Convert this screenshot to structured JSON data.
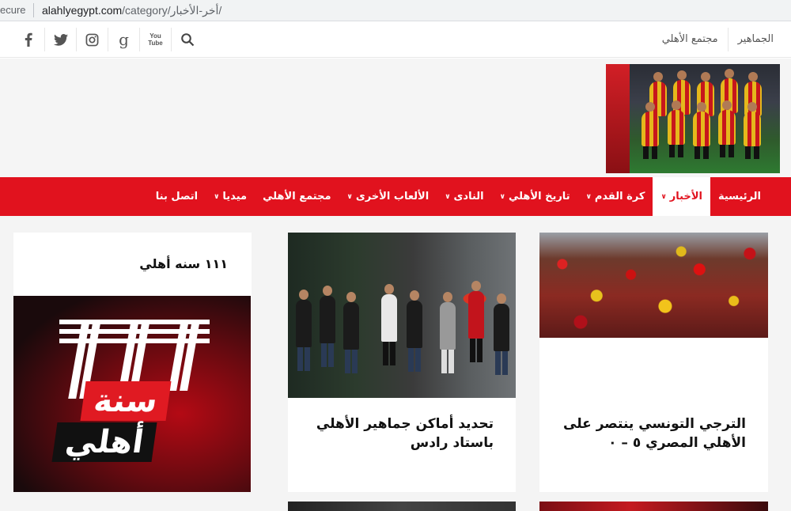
{
  "browser": {
    "secure_label": "ecure",
    "url_host": "alahlyegypt.com",
    "url_path": "/category/أخر-الأخبار/"
  },
  "topbar": {
    "links": [
      "الجماهير",
      "مجتمع الأهلي"
    ],
    "social_icons": [
      "facebook-icon",
      "twitter-icon",
      "instagram-icon",
      "google-icon",
      "youtube-icon",
      "search-icon"
    ],
    "youtube_text": "You Tube"
  },
  "nav": {
    "items": [
      {
        "label": "الرئيسية",
        "has_caret": false,
        "active": false
      },
      {
        "label": "الأخبار",
        "has_caret": true,
        "active": true
      },
      {
        "label": "كرة القدم",
        "has_caret": true,
        "active": false
      },
      {
        "label": "تاريخ الأهلي",
        "has_caret": true,
        "active": false
      },
      {
        "label": "النادى",
        "has_caret": true,
        "active": false
      },
      {
        "label": "الألعاب الأخرى",
        "has_caret": true,
        "active": false
      },
      {
        "label": "مجتمع الأهلي",
        "has_caret": false,
        "active": false
      },
      {
        "label": "ميديا",
        "has_caret": true,
        "active": false
      },
      {
        "label": "اتصل بنا",
        "has_caret": false,
        "active": false
      }
    ]
  },
  "sidebar": {
    "widget_title": "١١١ سنه أهلي",
    "logo_line1": "سنة",
    "logo_line2": "أهلي"
  },
  "articles": [
    {
      "title_line1": "الترجي التونسي ينتصر على",
      "title_line2": "الأهلي المصري ٥ – ٠"
    },
    {
      "title_line1": "تحديد أماكن جماهير الأهلي",
      "title_line2": "باستاد رادس"
    }
  ],
  "colors": {
    "brand_red": "#e1121e",
    "nav_text": "#ffffff",
    "page_bg": "#f4f4f4"
  }
}
